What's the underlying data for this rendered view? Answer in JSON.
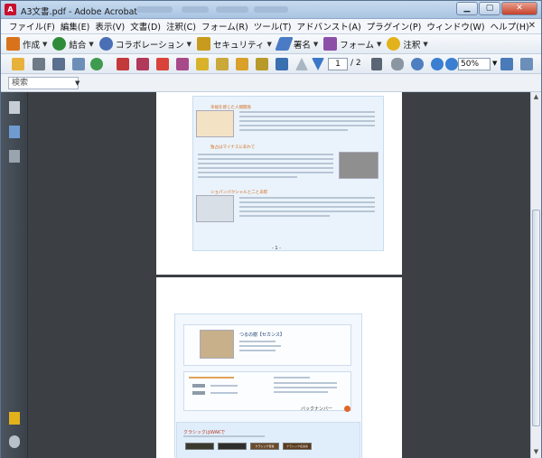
{
  "window": {
    "title": "A3文書.pdf - Adobe Acrobat"
  },
  "menu": {
    "items": [
      "ファイル(F)",
      "編集(E)",
      "表示(V)",
      "文書(D)",
      "注釈(C)",
      "フォーム(R)",
      "ツール(T)",
      "アドバンスト(A)",
      "プラグイン(P)",
      "ウィンドウ(W)",
      "ヘルプ(H)"
    ]
  },
  "tasks": [
    {
      "label": "作成",
      "color": "#d9731b"
    },
    {
      "label": "結合",
      "color": "#2e8b3a"
    },
    {
      "label": "コラボレーション",
      "color": "#4a6fb5"
    },
    {
      "label": "セキュリティ",
      "color": "#c89b1e"
    },
    {
      "label": "署名",
      "color": "#4a7bc4"
    },
    {
      "label": "フォーム",
      "color": "#8c4fa8"
    },
    {
      "label": "注釈",
      "color": "#e2b21c"
    }
  ],
  "navigation": {
    "current_page": "1",
    "total_pages": "/ 2",
    "zoom": "50%"
  },
  "search": {
    "placeholder": "検索"
  },
  "document": {
    "page1": {
      "headings": [
        "幸福を感じた人間関係",
        "独占はマイナスにあれて",
        "ショパンパクシャルと二とあ粋"
      ],
      "page_number": "- 1 -"
    },
    "page2": {
      "title_text": "つるの樹【セカンス】",
      "back_number": "バックナンバー",
      "footer_heading": "クラシックはWAKで",
      "buttons": [
        "",
        "",
        "クラシック音楽",
        "クラシック名演奏"
      ]
    }
  }
}
